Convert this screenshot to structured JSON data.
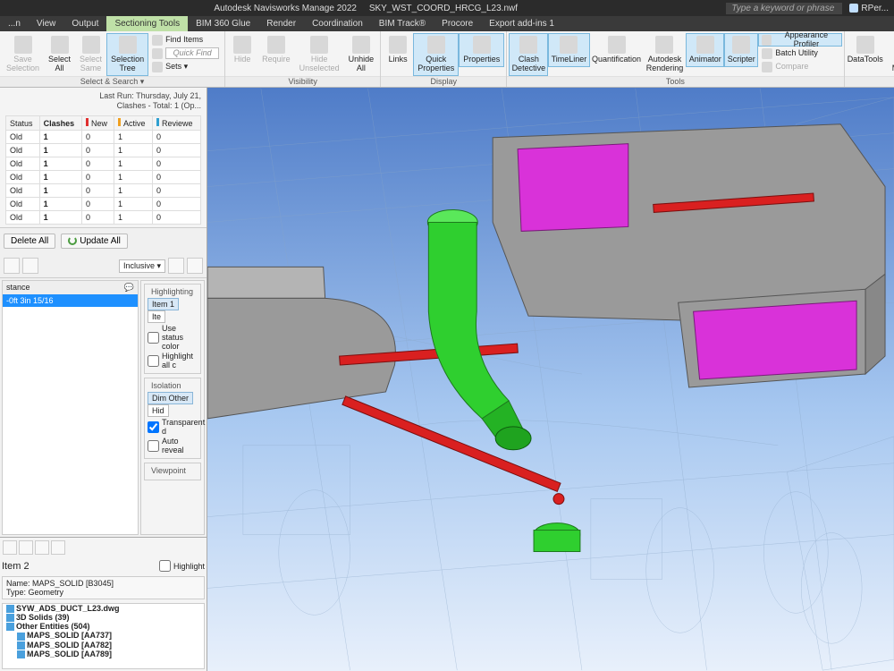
{
  "titlebar": {
    "app": "Autodesk Navisworks Manage 2022",
    "file": "SKY_WST_COORD_HRCG_L23.nwf",
    "search_placeholder": "Type a keyword or phrase",
    "user": "RPer..."
  },
  "menubar": {
    "items": [
      {
        "label": "...n"
      },
      {
        "label": "View"
      },
      {
        "label": "Output"
      },
      {
        "label": "Sectioning Tools",
        "active": true
      },
      {
        "label": "BIM 360 Glue"
      },
      {
        "label": "Render"
      },
      {
        "label": "Coordination"
      },
      {
        "label": "BIM Track®"
      },
      {
        "label": "Procore"
      },
      {
        "label": "Export add-ins 1"
      }
    ]
  },
  "ribbon": {
    "groups": [
      {
        "label": "Select & Search ▾",
        "buttons": [
          {
            "name": "save-selection",
            "label": "Save\nSelection",
            "disabled": true
          },
          {
            "name": "select-all",
            "label": "Select\nAll"
          },
          {
            "name": "select-same",
            "label": "Select\nSame",
            "disabled": true
          },
          {
            "name": "selection-tree",
            "label": "Selection\nTree",
            "active": true
          }
        ],
        "side": [
          {
            "name": "find-items",
            "label": "Find Items"
          },
          {
            "name": "quick-find",
            "placeholder": "Quick Find"
          },
          {
            "name": "sets",
            "label": "Sets ▾"
          }
        ]
      },
      {
        "label": "Visibility",
        "buttons": [
          {
            "name": "hide",
            "label": "Hide",
            "disabled": true
          },
          {
            "name": "require",
            "label": "Require",
            "disabled": true
          },
          {
            "name": "hide-unselected",
            "label": "Hide\nUnselected",
            "disabled": true
          },
          {
            "name": "unhide-all",
            "label": "Unhide\nAll"
          }
        ]
      },
      {
        "label": "Display",
        "buttons": [
          {
            "name": "links",
            "label": "Links"
          },
          {
            "name": "quick-properties",
            "label": "Quick\nProperties",
            "active": true
          },
          {
            "name": "properties",
            "label": "Properties",
            "active": true
          }
        ]
      },
      {
        "label": "Tools",
        "buttons": [
          {
            "name": "clash-detective",
            "label": "Clash\nDetective",
            "active": true
          },
          {
            "name": "timeliner",
            "label": "TimeLiner",
            "active": true
          },
          {
            "name": "quantification",
            "label": "Quantification"
          },
          {
            "name": "autodesk-rendering",
            "label": "Autodesk\nRendering"
          },
          {
            "name": "animator",
            "label": "Animator",
            "active": true
          },
          {
            "name": "scripter",
            "label": "Scripter",
            "active": true
          }
        ],
        "side": [
          {
            "name": "appearance-profiler",
            "label": "Appearance Profiler",
            "active": true
          },
          {
            "name": "batch-utility",
            "label": "Batch Utility"
          },
          {
            "name": "compare",
            "label": "Compare",
            "disabled": true
          }
        ]
      },
      {
        "label": "",
        "buttons": [
          {
            "name": "datatools",
            "label": "DataTools"
          },
          {
            "name": "app-manager",
            "label": "App Manager"
          }
        ]
      }
    ]
  },
  "clash": {
    "last_run_label": "Last Run:",
    "last_run": "Thursday, July 21,",
    "clashes_label": "Clashes - Total: 1 (Op...",
    "headers": [
      "Status",
      "Clashes",
      "New",
      "Active",
      "Reviewe"
    ],
    "header_colors": [
      "",
      "",
      "#e03030",
      "#f0a020",
      "#30a0d0"
    ],
    "rows": [
      [
        "Old",
        "1",
        "0",
        "1",
        "0"
      ],
      [
        "Old",
        "1",
        "0",
        "1",
        "0"
      ],
      [
        "Old",
        "1",
        "0",
        "1",
        "0"
      ],
      [
        "Old",
        "1",
        "0",
        "1",
        "0"
      ],
      [
        "Old",
        "1",
        "0",
        "1",
        "0"
      ],
      [
        "Old",
        "1",
        "0",
        "1",
        "0"
      ],
      [
        "Old",
        "1",
        "0",
        "1",
        "0"
      ]
    ],
    "delete_all": "Delete All",
    "update_all": "Update All"
  },
  "items": {
    "inclusive": "Inclusive ▾",
    "left_header": "stance",
    "left_value": "-0ft 3in 15/16",
    "highlighting": "Highlighting",
    "item1": "Item 1",
    "item": "Ite",
    "use_status": "Use status color",
    "highlight_all": "Highlight all c",
    "isolation": "Isolation",
    "dim_other": "Dim Other",
    "hide": "Hid",
    "transparent": "Transparent d",
    "auto_reveal": "Auto reveal",
    "viewpoint": "Viewpoint"
  },
  "tree": {
    "item2": "Item 2",
    "highlight": "Highlight",
    "name_label": "Name: MAPS_SOLID [B3045]",
    "type_label": "Type: Geometry",
    "nodes": [
      {
        "label": "SYW_ADS_DUCT_L23.dwg",
        "bold": true,
        "icon": "dwg"
      },
      {
        "label": "3D Solids (39)",
        "bold": true,
        "icon": "group"
      },
      {
        "label": "Other Entities (504)",
        "bold": true,
        "icon": "group"
      },
      {
        "label": "MAPS_SOLID [AA737]",
        "bold": true,
        "icon": "solid",
        "indent": 1
      },
      {
        "label": "MAPS_SOLID [AA782]",
        "bold": true,
        "icon": "solid",
        "indent": 1
      },
      {
        "label": "MAPS_SOLID [AA789]",
        "bold": true,
        "icon": "solid",
        "indent": 1
      }
    ]
  },
  "colors": {
    "duct": "#9a9a9a",
    "duct_open": "#d932d9",
    "pipe": "#d92020",
    "elbow": "#2fcf2f"
  }
}
